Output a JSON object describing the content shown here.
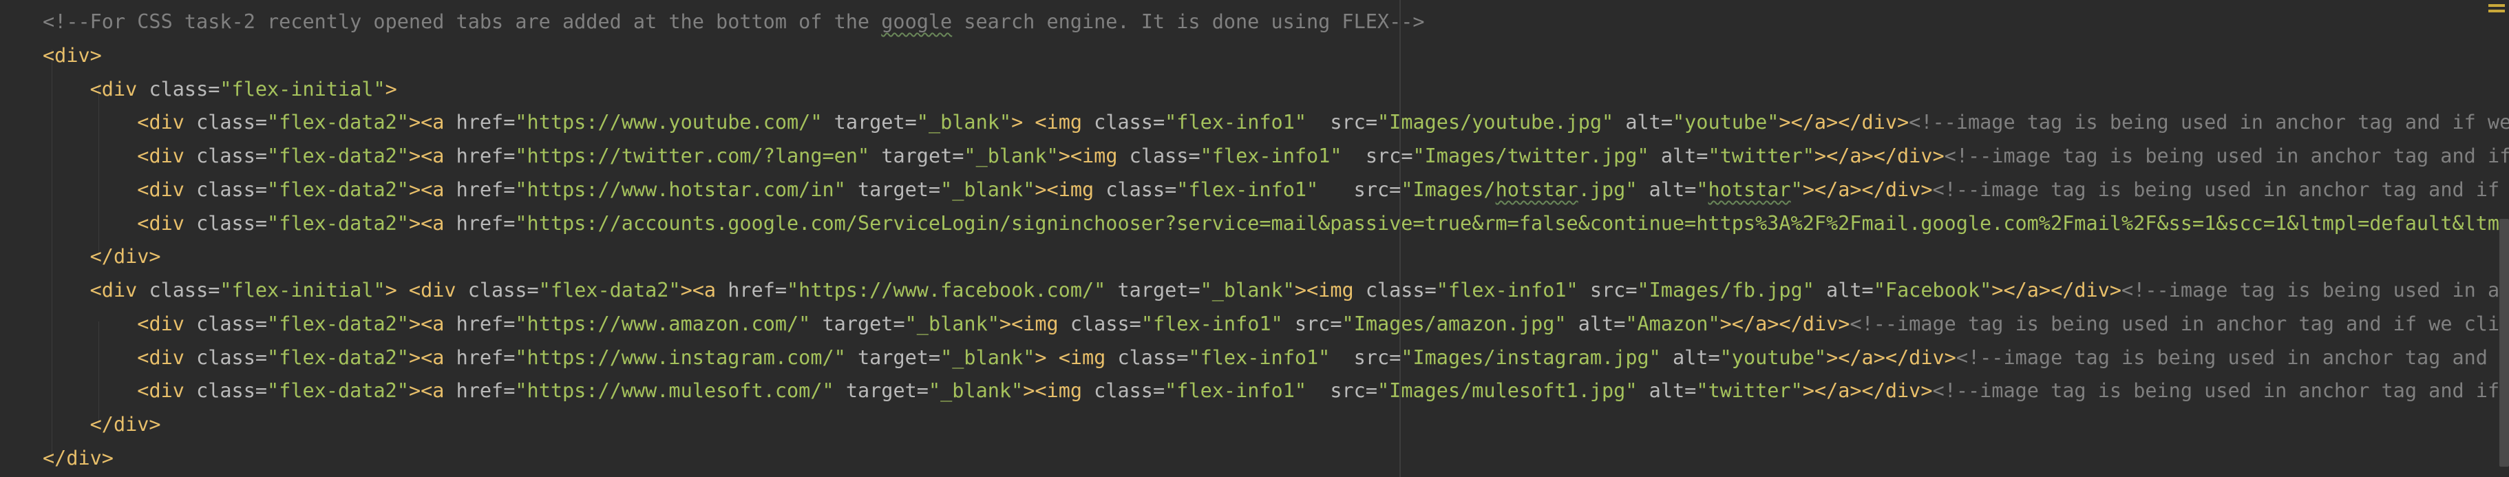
{
  "editor": {
    "colors": {
      "background": "#2b2b2b",
      "tag": "#e8bf6a",
      "attribute": "#bababa",
      "value": "#a5c25c",
      "comment": "#808080",
      "text": "#a9b7c6"
    },
    "lines": [
      [
        {
          "c": "comment",
          "t": "<!--For CSS task-2 recently opened tabs are added at the bottom of the "
        },
        {
          "c": "comment typo",
          "t": "google"
        },
        {
          "c": "comment",
          "t": " search engine. It is done using FLEX-->"
        }
      ],
      [
        {
          "c": "tag",
          "t": "<div>"
        }
      ],
      [
        {
          "c": "text",
          "t": "    "
        },
        {
          "c": "tag",
          "t": "<div "
        },
        {
          "c": "attr",
          "t": "class="
        },
        {
          "c": "val",
          "t": "\"flex-initial\""
        },
        {
          "c": "tag",
          "t": ">"
        }
      ],
      [
        {
          "c": "text",
          "t": "        "
        },
        {
          "c": "tag",
          "t": "<div "
        },
        {
          "c": "attr",
          "t": "class="
        },
        {
          "c": "val",
          "t": "\"flex-data2\""
        },
        {
          "c": "tag",
          "t": "><a "
        },
        {
          "c": "attr",
          "t": "href="
        },
        {
          "c": "val",
          "t": "\"https://www.youtube.com/\""
        },
        {
          "c": "tag",
          "t": " "
        },
        {
          "c": "attr",
          "t": "target="
        },
        {
          "c": "val",
          "t": "\"_blank\""
        },
        {
          "c": "tag",
          "t": "> <img "
        },
        {
          "c": "attr",
          "t": "class="
        },
        {
          "c": "val",
          "t": "\"flex-info1\""
        },
        {
          "c": "tag",
          "t": "  "
        },
        {
          "c": "attr",
          "t": "src="
        },
        {
          "c": "val",
          "t": "\"Images/youtube.jpg\""
        },
        {
          "c": "tag",
          "t": " "
        },
        {
          "c": "attr",
          "t": "alt="
        },
        {
          "c": "val",
          "t": "\"youtube\""
        },
        {
          "c": "tag",
          "t": "></a></div>"
        },
        {
          "c": "comment",
          "t": "<!--image tag is being used in anchor tag and if we c"
        }
      ],
      [
        {
          "c": "text",
          "t": "        "
        },
        {
          "c": "tag",
          "t": "<div "
        },
        {
          "c": "attr",
          "t": "class="
        },
        {
          "c": "val",
          "t": "\"flex-data2\""
        },
        {
          "c": "tag",
          "t": "><a "
        },
        {
          "c": "attr",
          "t": "href="
        },
        {
          "c": "val",
          "t": "\"https://twitter.com/?lang=en\""
        },
        {
          "c": "tag",
          "t": " "
        },
        {
          "c": "attr",
          "t": "target="
        },
        {
          "c": "val",
          "t": "\"_blank\""
        },
        {
          "c": "tag",
          "t": "><img "
        },
        {
          "c": "attr",
          "t": "class="
        },
        {
          "c": "val",
          "t": "\"flex-info1\""
        },
        {
          "c": "tag",
          "t": "  "
        },
        {
          "c": "attr",
          "t": "src="
        },
        {
          "c": "val",
          "t": "\"Images/twitter.jpg\""
        },
        {
          "c": "tag",
          "t": " "
        },
        {
          "c": "attr",
          "t": "alt="
        },
        {
          "c": "val",
          "t": "\"twitter\""
        },
        {
          "c": "tag",
          "t": "></a></div>"
        },
        {
          "c": "comment",
          "t": "<!--image tag is being used in anchor tag and if w"
        }
      ],
      [
        {
          "c": "text",
          "t": "        "
        },
        {
          "c": "tag",
          "t": "<div "
        },
        {
          "c": "attr",
          "t": "class="
        },
        {
          "c": "val",
          "t": "\"flex-data2\""
        },
        {
          "c": "tag",
          "t": "><a "
        },
        {
          "c": "attr",
          "t": "href="
        },
        {
          "c": "val",
          "t": "\"https://www.hotstar.com/in\""
        },
        {
          "c": "tag",
          "t": " "
        },
        {
          "c": "attr",
          "t": "target="
        },
        {
          "c": "val",
          "t": "\"_blank\""
        },
        {
          "c": "tag",
          "t": "><img "
        },
        {
          "c": "attr",
          "t": "class="
        },
        {
          "c": "val",
          "t": "\"flex-info1\""
        },
        {
          "c": "tag",
          "t": "   "
        },
        {
          "c": "attr",
          "t": "src="
        },
        {
          "c": "val",
          "t": "\"Images/"
        },
        {
          "c": "val typo",
          "t": "hotstar"
        },
        {
          "c": "val",
          "t": ".jpg\""
        },
        {
          "c": "tag",
          "t": " "
        },
        {
          "c": "attr",
          "t": "alt="
        },
        {
          "c": "val",
          "t": "\""
        },
        {
          "c": "val typo",
          "t": "hotstar"
        },
        {
          "c": "val",
          "t": "\""
        },
        {
          "c": "tag",
          "t": "></a></div>"
        },
        {
          "c": "comment",
          "t": "<!--image tag is being used in anchor tag and if w"
        }
      ],
      [
        {
          "c": "text",
          "t": "        "
        },
        {
          "c": "tag",
          "t": "<div "
        },
        {
          "c": "attr",
          "t": "class="
        },
        {
          "c": "val",
          "t": "\"flex-data2\""
        },
        {
          "c": "tag",
          "t": "><a "
        },
        {
          "c": "attr",
          "t": "href="
        },
        {
          "c": "val",
          "t": "\"https://accounts.google.com/ServiceLogin/signinchooser?service=mail&passive=true&rm=false&continue=https%3A%2F%2Fmail.google.com%2Fmail%2F&ss=1&scc=1&ltmpl=default&ltmplc"
        }
      ],
      [
        {
          "c": "text",
          "t": "    "
        },
        {
          "c": "tag",
          "t": "</div>"
        }
      ],
      [
        {
          "c": "text",
          "t": "    "
        },
        {
          "c": "tag",
          "t": "<div "
        },
        {
          "c": "attr",
          "t": "class="
        },
        {
          "c": "val",
          "t": "\"flex-initial\""
        },
        {
          "c": "tag",
          "t": "> <div "
        },
        {
          "c": "attr",
          "t": "class="
        },
        {
          "c": "val",
          "t": "\"flex-data2\""
        },
        {
          "c": "tag",
          "t": "><a "
        },
        {
          "c": "attr",
          "t": "href="
        },
        {
          "c": "val",
          "t": "\"https://www.facebook.com/\""
        },
        {
          "c": "tag",
          "t": " "
        },
        {
          "c": "attr",
          "t": "target="
        },
        {
          "c": "val",
          "t": "\"_blank\""
        },
        {
          "c": "tag",
          "t": "><img "
        },
        {
          "c": "attr",
          "t": "class="
        },
        {
          "c": "val",
          "t": "\"flex-info1\""
        },
        {
          "c": "tag",
          "t": " "
        },
        {
          "c": "attr",
          "t": "src="
        },
        {
          "c": "val",
          "t": "\"Images/fb.jpg\""
        },
        {
          "c": "tag",
          "t": " "
        },
        {
          "c": "attr",
          "t": "alt="
        },
        {
          "c": "val",
          "t": "\"Facebook\""
        },
        {
          "c": "tag",
          "t": "></a></div>"
        },
        {
          "c": "comment",
          "t": "<!--image tag is being used in anch"
        }
      ],
      [
        {
          "c": "text",
          "t": "        "
        },
        {
          "c": "tag",
          "t": "<div "
        },
        {
          "c": "attr",
          "t": "class="
        },
        {
          "c": "val",
          "t": "\"flex-data2\""
        },
        {
          "c": "tag",
          "t": "><a "
        },
        {
          "c": "attr",
          "t": "href="
        },
        {
          "c": "val",
          "t": "\"https://www.amazon.com/\""
        },
        {
          "c": "tag",
          "t": " "
        },
        {
          "c": "attr",
          "t": "target="
        },
        {
          "c": "val",
          "t": "\"_blank\""
        },
        {
          "c": "tag",
          "t": "><img "
        },
        {
          "c": "attr",
          "t": "class="
        },
        {
          "c": "val",
          "t": "\"flex-info1\""
        },
        {
          "c": "tag",
          "t": " "
        },
        {
          "c": "attr",
          "t": "src="
        },
        {
          "c": "val",
          "t": "\"Images/amazon.jpg\""
        },
        {
          "c": "tag",
          "t": " "
        },
        {
          "c": "attr",
          "t": "alt="
        },
        {
          "c": "val",
          "t": "\"Amazon\""
        },
        {
          "c": "tag",
          "t": "></a></div>"
        },
        {
          "c": "comment",
          "t": "<!--image tag is being used in anchor tag and if we click"
        }
      ],
      [
        {
          "c": "text",
          "t": "        "
        },
        {
          "c": "tag",
          "t": "<div "
        },
        {
          "c": "attr",
          "t": "class="
        },
        {
          "c": "val",
          "t": "\"flex-data2\""
        },
        {
          "c": "tag",
          "t": "><a "
        },
        {
          "c": "attr",
          "t": "href="
        },
        {
          "c": "val",
          "t": "\"https://www.instagram.com/\""
        },
        {
          "c": "tag",
          "t": " "
        },
        {
          "c": "attr",
          "t": "target="
        },
        {
          "c": "val",
          "t": "\"_blank\""
        },
        {
          "c": "tag",
          "t": "> <img "
        },
        {
          "c": "attr",
          "t": "class="
        },
        {
          "c": "val",
          "t": "\"flex-info1\""
        },
        {
          "c": "tag",
          "t": "  "
        },
        {
          "c": "attr",
          "t": "src="
        },
        {
          "c": "val",
          "t": "\"Images/instagram.jpg\""
        },
        {
          "c": "tag",
          "t": " "
        },
        {
          "c": "attr",
          "t": "alt="
        },
        {
          "c": "val",
          "t": "\"youtube\""
        },
        {
          "c": "tag",
          "t": "></a></div>"
        },
        {
          "c": "comment",
          "t": "<!--image tag is being used in anchor tag and if"
        }
      ],
      [
        {
          "c": "text",
          "t": "        "
        },
        {
          "c": "tag",
          "t": "<div "
        },
        {
          "c": "attr",
          "t": "class="
        },
        {
          "c": "val",
          "t": "\"flex-data2\""
        },
        {
          "c": "tag",
          "t": "><a "
        },
        {
          "c": "attr",
          "t": "href="
        },
        {
          "c": "val",
          "t": "\"https://www.mulesoft.com/\""
        },
        {
          "c": "tag",
          "t": " "
        },
        {
          "c": "attr",
          "t": "target="
        },
        {
          "c": "val",
          "t": "\"_blank\""
        },
        {
          "c": "tag",
          "t": "><img "
        },
        {
          "c": "attr",
          "t": "class="
        },
        {
          "c": "val",
          "t": "\"flex-info1\""
        },
        {
          "c": "tag",
          "t": "  "
        },
        {
          "c": "attr",
          "t": "src="
        },
        {
          "c": "val",
          "t": "\"Images/mulesoft1.jpg\""
        },
        {
          "c": "tag",
          "t": " "
        },
        {
          "c": "attr",
          "t": "alt="
        },
        {
          "c": "val",
          "t": "\"twitter\""
        },
        {
          "c": "tag",
          "t": "></a></div>"
        },
        {
          "c": "comment",
          "t": "<!--image tag is being used in anchor tag and if w"
        }
      ],
      [
        {
          "c": "text",
          "t": "    "
        },
        {
          "c": "tag",
          "t": "</div>"
        }
      ],
      [
        {
          "c": "tag",
          "t": "</div>"
        }
      ]
    ]
  }
}
